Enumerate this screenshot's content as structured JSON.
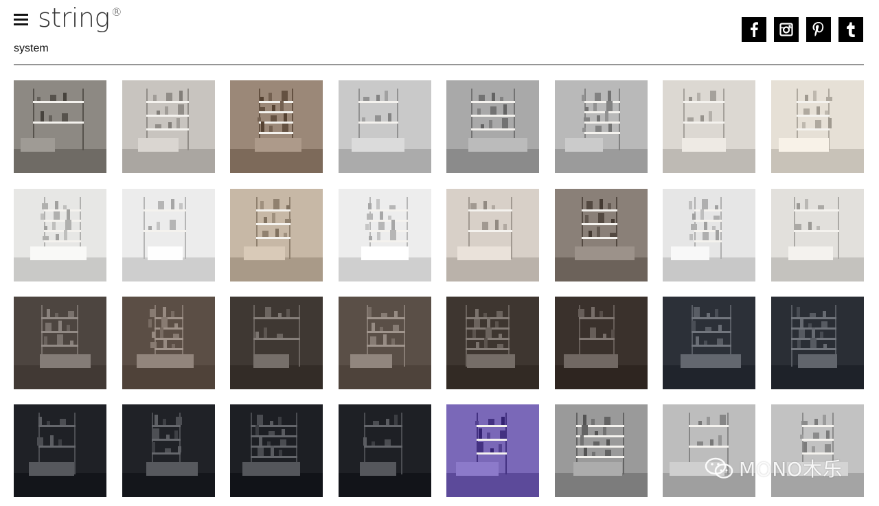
{
  "header": {
    "logo_text": "string",
    "logo_mark": "®",
    "subtitle": "system"
  },
  "social": [
    {
      "name": "facebook-icon",
      "glyph": "f"
    },
    {
      "name": "instagram-icon",
      "glyph": ""
    },
    {
      "name": "pinterest-icon",
      "glyph": "P"
    },
    {
      "name": "tumblr-icon",
      "glyph": "t"
    }
  ],
  "gallery": {
    "rows": 4,
    "columns": 8,
    "tiles": [
      {
        "scene": "loft-windows-low-cabinets",
        "bg": "#8d8983"
      },
      {
        "scene": "window-shelf-books",
        "bg": "#c8c4bf"
      },
      {
        "scene": "dark-cabinet-books",
        "bg": "#9b8878"
      },
      {
        "scene": "kitchen-pegboard-pans",
        "bg": "#c9c9c9"
      },
      {
        "scene": "pots-closeup",
        "bg": "#a9a9a9"
      },
      {
        "scene": "pots-pegboard-spatula",
        "bg": "#b9b9b9"
      },
      {
        "scene": "white-desk-shelf",
        "bg": "#dcd8d2"
      },
      {
        "scene": "kids-room-shelves",
        "bg": "#e6e0d6"
      },
      {
        "scene": "white-hallway-chair",
        "bg": "#e7e7e5"
      },
      {
        "scene": "wardrobe-clothes",
        "bg": "#ececec"
      },
      {
        "scene": "shoe-shelf-bag",
        "bg": "#c7b8a6"
      },
      {
        "scene": "wardrobe-bag-coat",
        "bg": "#ededed"
      },
      {
        "scene": "red-stool-shelves",
        "bg": "#d8d0c8"
      },
      {
        "scene": "industrial-window-brick",
        "bg": "#8a8078"
      },
      {
        "scene": "drawer-leather-tray",
        "bg": "#e6e6e6"
      },
      {
        "scene": "animal-figurines",
        "bg": "#e2e0dc"
      },
      {
        "scene": "dark-wall-white-shelves",
        "bg": "#4d4540"
      },
      {
        "scene": "white-cabinet-vases",
        "bg": "#5b4e45"
      },
      {
        "scene": "ceramic-vases-dark",
        "bg": "#3f3833"
      },
      {
        "scene": "living-shelves-clock",
        "bg": "#5a4f47"
      },
      {
        "scene": "desk-chair-dark",
        "bg": "#3e3630"
      },
      {
        "scene": "jars-on-cabinet",
        "bg": "#3a312c"
      },
      {
        "scene": "navy-wall-plant",
        "bg": "#2c3038"
      },
      {
        "scene": "navy-desk-magazine",
        "bg": "#2a2e35"
      },
      {
        "scene": "black-wall-shelves",
        "bg": "#1f2126"
      },
      {
        "scene": "black-tools-closeup",
        "bg": "#202227"
      },
      {
        "scene": "black-shelves-boxes",
        "bg": "#1d1f24"
      },
      {
        "scene": "black-shelves-hooks",
        "bg": "#1e2025"
      },
      {
        "scene": "purple-wall-bike",
        "bg": "#7a68b8"
      },
      {
        "scene": "concrete-bike-shelves",
        "bg": "#9a9a9a"
      },
      {
        "scene": "lamp-concrete-wall",
        "bg": "#bdbdbd"
      },
      {
        "scene": "lamp-concrete-wall-2",
        "bg": "#c2c2c2"
      }
    ]
  },
  "watermark": {
    "text": "MONO木乐"
  }
}
